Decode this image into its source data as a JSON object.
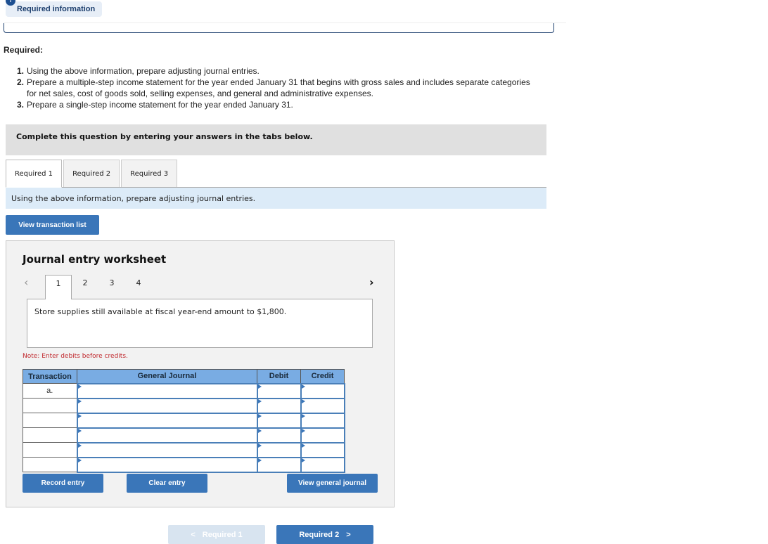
{
  "header": {
    "alert_glyph": "!",
    "badge_label": "Required information"
  },
  "required": {
    "heading": "Required:",
    "items": [
      {
        "num": "1.",
        "text": "Using the above information, prepare adjusting journal entries."
      },
      {
        "num": "2.",
        "text": "Prepare a multiple-step income statement for the year ended January 31 that begins with gross sales and includes separate categories for net sales, cost of goods sold, selling expenses, and general and administrative expenses."
      },
      {
        "num": "3.",
        "text": "Prepare a single-step income statement for the year ended January 31."
      }
    ]
  },
  "instructions": "Complete this question by entering your answers in the tabs below.",
  "tabs": [
    {
      "label": "Required 1",
      "active": true
    },
    {
      "label": "Required 2",
      "active": false
    },
    {
      "label": "Required 3",
      "active": false
    }
  ],
  "tab_instruction": "Using the above information, prepare adjusting journal entries.",
  "view_transaction_list_label": "View transaction list",
  "worksheet": {
    "title": "Journal entry worksheet",
    "prev_icon": "‹",
    "next_icon": "›",
    "pages": [
      "1",
      "2",
      "3",
      "4"
    ],
    "active_page": "1",
    "description": "Store supplies still available at fiscal year-end amount to $1,800.",
    "note": "Note: Enter debits before credits.",
    "table": {
      "headers": [
        "Transaction",
        "General Journal",
        "Debit",
        "Credit"
      ],
      "rows": [
        {
          "transaction": "a.",
          "account": "",
          "debit": "",
          "credit": ""
        },
        {
          "transaction": "",
          "account": "",
          "debit": "",
          "credit": ""
        },
        {
          "transaction": "",
          "account": "",
          "debit": "",
          "credit": ""
        },
        {
          "transaction": "",
          "account": "",
          "debit": "",
          "credit": ""
        },
        {
          "transaction": "",
          "account": "",
          "debit": "",
          "credit": ""
        },
        {
          "transaction": "",
          "account": "",
          "debit": "",
          "credit": ""
        }
      ]
    },
    "buttons": {
      "record": "Record entry",
      "clear": "Clear entry",
      "view_general_journal": "View general journal"
    }
  },
  "navigation": {
    "prev_label": "Required 1",
    "prev_icon": "<",
    "next_label": "Required 2",
    "next_icon": ">"
  },
  "colors": {
    "button_blue": "#3a76b9",
    "header_blue": "#79ace3",
    "note_red": "#c0282d",
    "instruction_bg": "#dcebf8"
  }
}
